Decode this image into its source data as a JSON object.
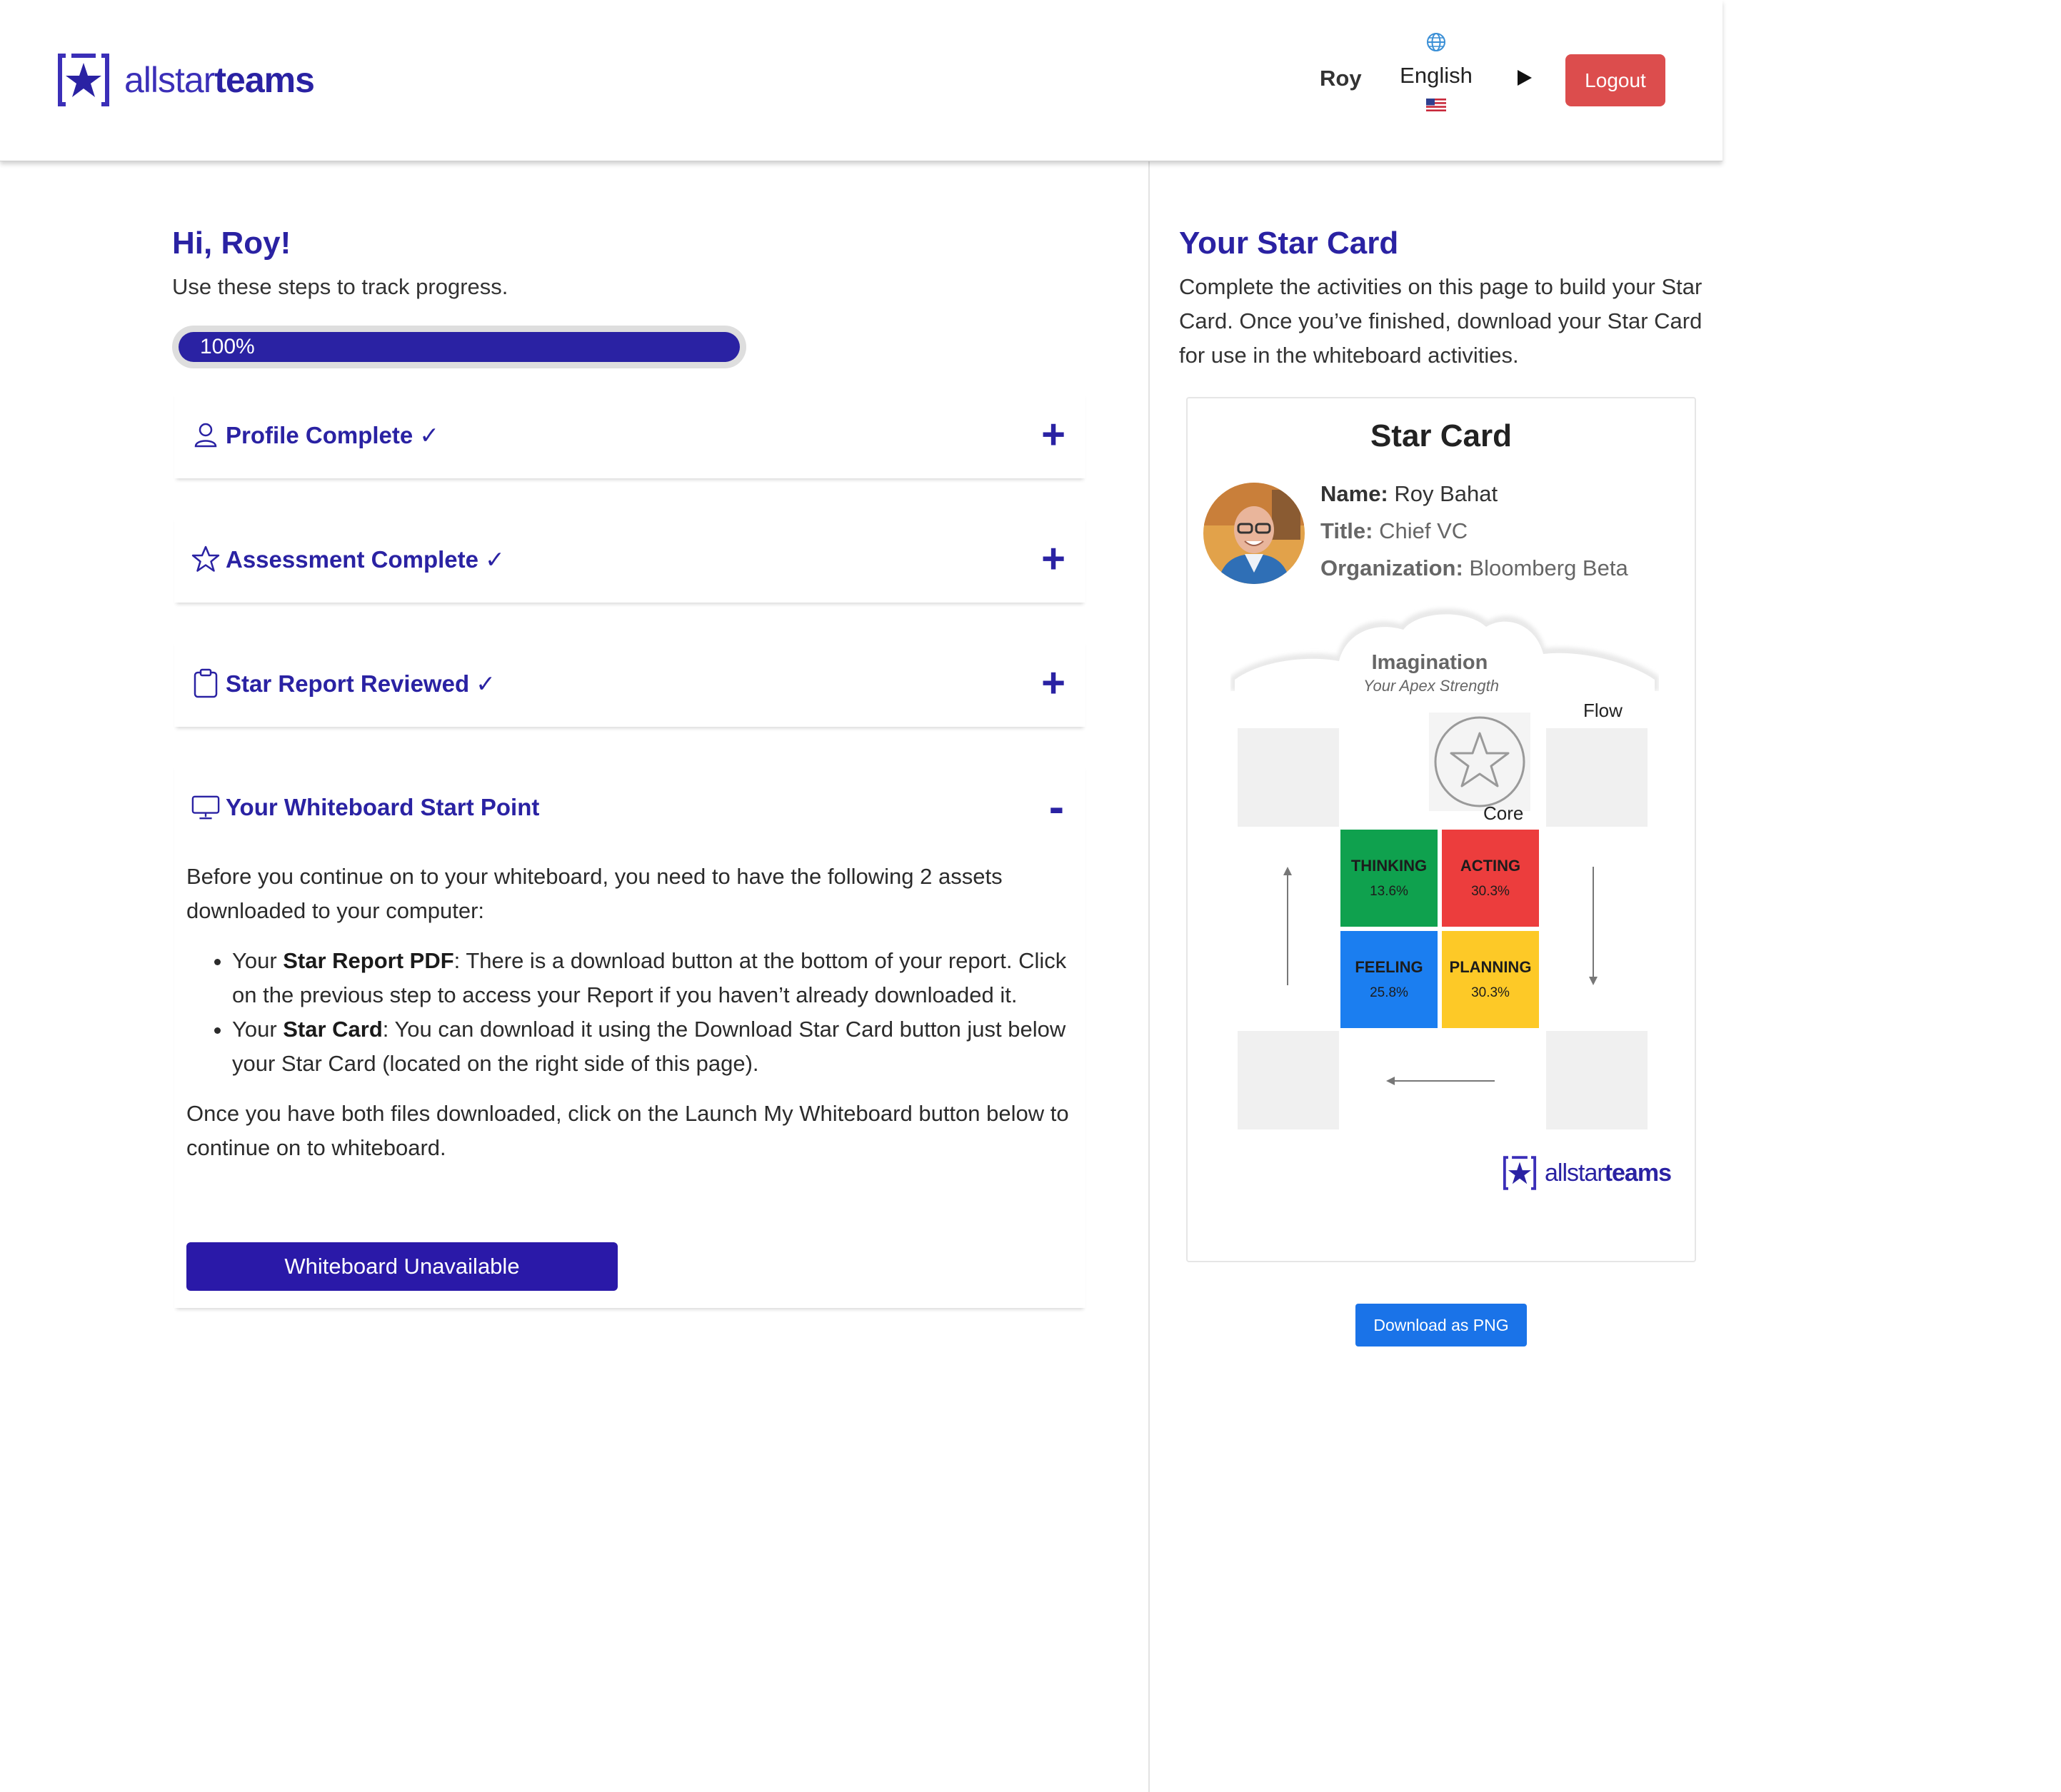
{
  "header": {
    "logo_text_light": "allstar",
    "logo_text_bold": "teams",
    "user_name": "Roy",
    "language": "English",
    "logout_label": "Logout"
  },
  "left": {
    "greeting": "Hi, Roy!",
    "subtitle": "Use these steps to track progress.",
    "progress": {
      "label": "100%",
      "percent": 100
    },
    "steps": [
      {
        "title": "Profile Complete ✓",
        "toggle": "+",
        "icon": "user-icon"
      },
      {
        "title": "Assessment Complete ✓",
        "toggle": "+",
        "icon": "star-outline-icon"
      },
      {
        "title": "Star Report Reviewed ✓",
        "toggle": "+",
        "icon": "clipboard-icon"
      },
      {
        "title": "Your Whiteboard Start Point",
        "toggle": "-",
        "icon": "monitor-icon"
      }
    ],
    "whiteboard": {
      "intro": "Before you continue on to your whiteboard, you need to have the following 2 assets downloaded to your computer:",
      "bullet1_pre": "Your ",
      "bullet1_bold": "Star Report PDF",
      "bullet1_post": ": There is a download button at the bottom of your report. Click on the previous step to access your Report if you haven’t already downloaded it.",
      "bullet2_pre": "Your ",
      "bullet2_bold": "Star Card",
      "bullet2_post": ": You can download it using the Download Star Card button just below your Star Card (located on the right side of this page).",
      "outro": "Once you have both files downloaded, click on the Launch My Whiteboard button below to continue on to whiteboard.",
      "button_label": "Whiteboard Unavailable"
    }
  },
  "right": {
    "heading": "Your Star Card",
    "description": "Complete the activities on this page to build your Star Card. Once you’ve finished, download your Star Card for use in the whiteboard activities.",
    "card": {
      "title": "Star Card",
      "name_label": "Name:",
      "name_value": "Roy Bahat",
      "title_label": "Title:",
      "title_value": "Chief VC",
      "org_label": "Organization:",
      "org_value": "Bloomberg Beta",
      "apex_name": "Imagination",
      "apex_caption": "Your Apex Strength",
      "flow_label": "Flow",
      "core_label": "Core",
      "quadrants": [
        {
          "name": "THINKING",
          "value": "13.6%",
          "color": "#0fa14e"
        },
        {
          "name": "ACTING",
          "value": "30.3%",
          "color": "#ec3d3d"
        },
        {
          "name": "FEELING",
          "value": "25.8%",
          "color": "#1b7ef0"
        },
        {
          "name": "PLANNING",
          "value": "30.3%",
          "color": "#fdc927"
        }
      ],
      "logo_light": "allstar",
      "logo_bold": "teams"
    },
    "download_label": "Download as PNG"
  },
  "colors": {
    "brand": "#2a22a3",
    "logout": "#dc4d4d",
    "download": "#1a73e8"
  }
}
